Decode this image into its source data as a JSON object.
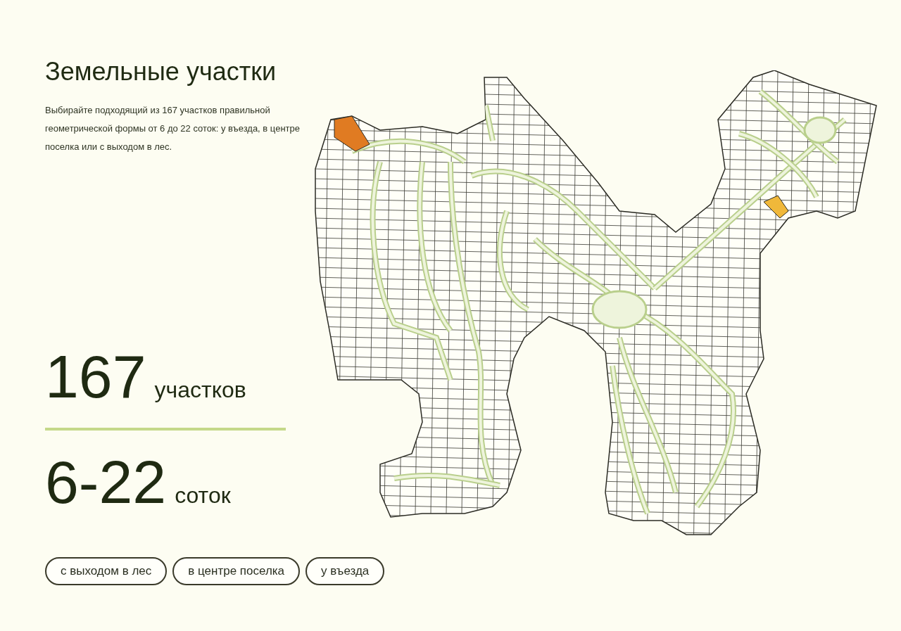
{
  "title": "Земельные участки",
  "description": "Выбирайте подходящий из 167 участков правильной геометрической формы от 6 до 22 соток: у въезда, в центре поселка или с выходом в лес.",
  "stats": [
    {
      "value": "167",
      "unit": "участков"
    },
    {
      "value": "6-22",
      "unit": "соток"
    }
  ],
  "filters": [
    {
      "label": "с выходом в лес",
      "selected": false
    },
    {
      "label": "в центре поселка",
      "selected": false
    },
    {
      "label": "у въезда",
      "selected": false
    }
  ],
  "map": {
    "highlighted_plots": [
      {
        "color": "#e07b22"
      },
      {
        "color": "#f0b83a"
      }
    ]
  }
}
